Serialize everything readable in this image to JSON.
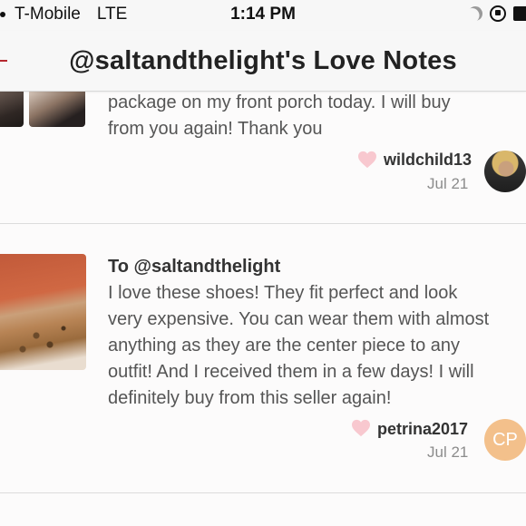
{
  "status_bar": {
    "carrier": "T-Mobile",
    "network": "LTE",
    "time": "1:14 PM"
  },
  "nav": {
    "title": "@saltandthelight's Love Notes"
  },
  "notes": [
    {
      "text_lines": [
        "package on my front porch today. I will buy",
        "from you again! Thank you"
      ],
      "username": "wildchild13",
      "date": "Jul 21"
    },
    {
      "to": "To @saltandthelight",
      "text_lines": [
        "I love these shoes! They fit perfect and look",
        "very expensive. You can wear them with almost",
        "anything as they are the center piece to any",
        "outfit! And I received them in a few days! I will",
        "definitely buy from this seller again!"
      ],
      "username": "petrina2017",
      "date": "Jul 21",
      "avatar_initials": "CP"
    }
  ],
  "colors": {
    "heart": "#f8c8cf",
    "avatar_cp": "#f3c08b",
    "accent": "#b5282f"
  }
}
